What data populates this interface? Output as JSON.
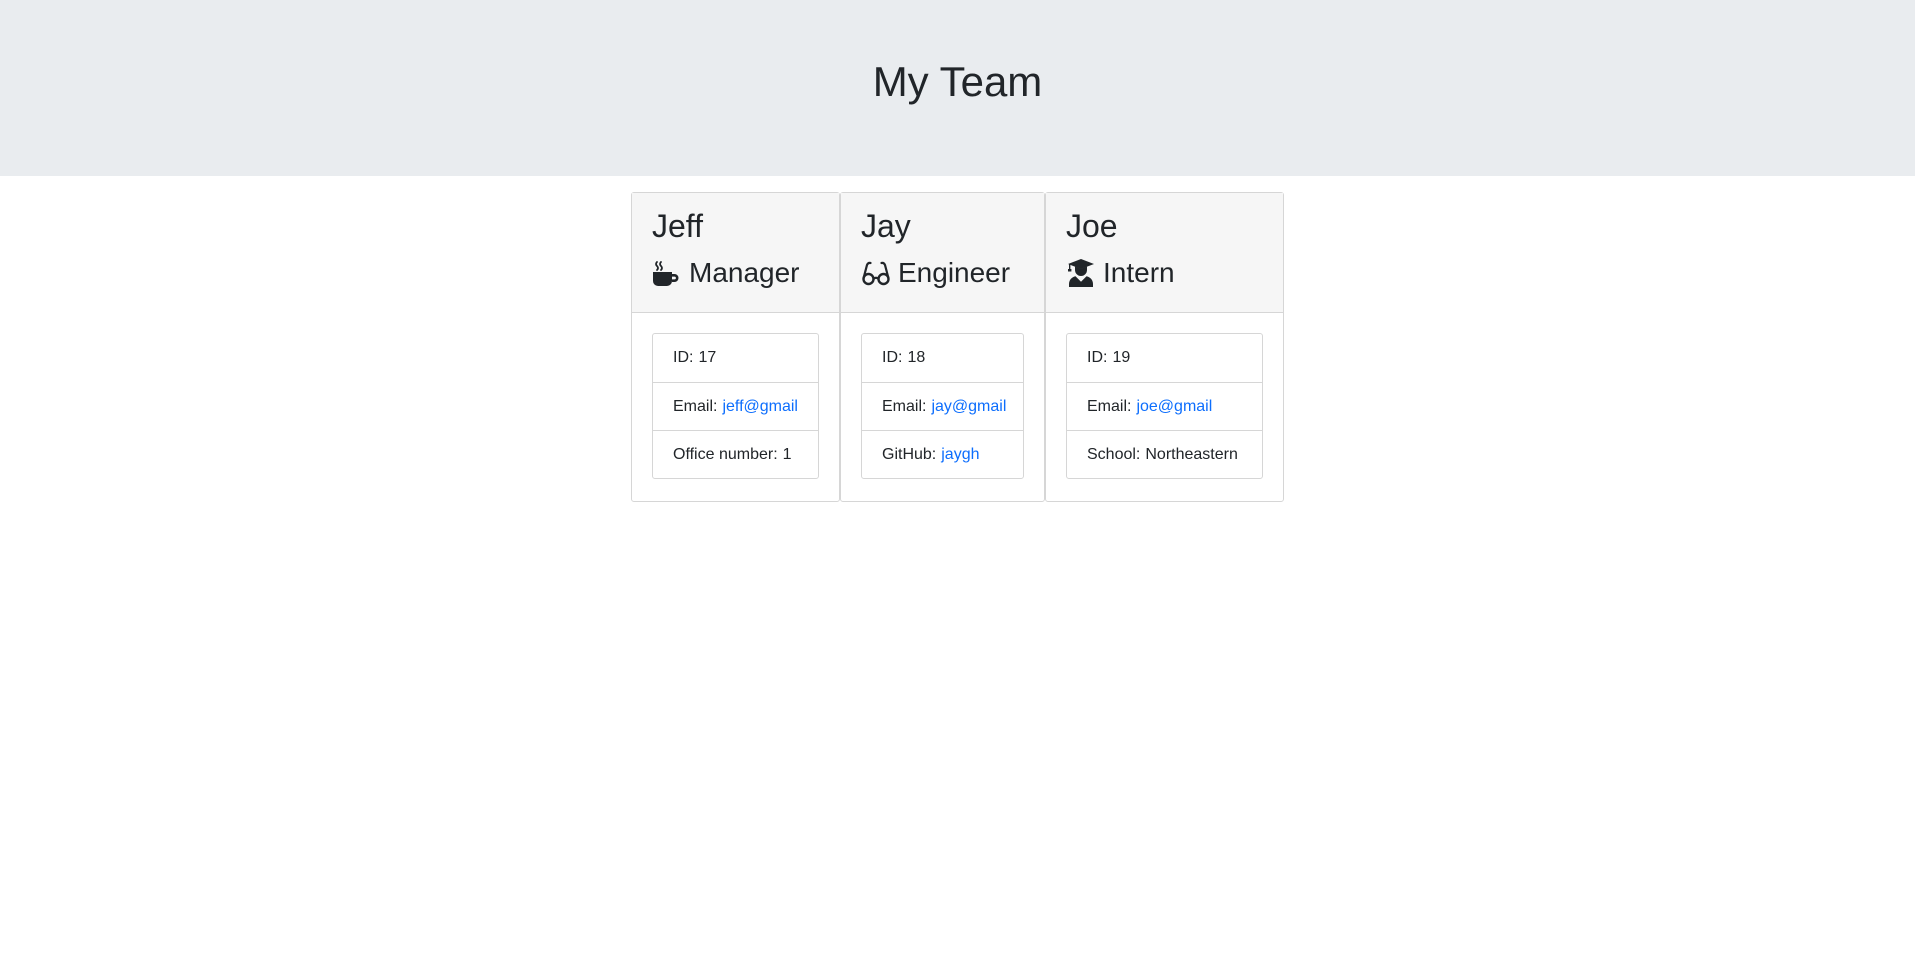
{
  "header": {
    "title": "My Team"
  },
  "team": [
    {
      "name": "Jeff",
      "role": "Manager",
      "icon": "coffee-mug-icon",
      "id_label": "ID:",
      "id": "17",
      "email_label": "Email:",
      "email": "jeff@gmail",
      "extra_label": "Office number:",
      "extra_value": "1"
    },
    {
      "name": "Jay",
      "role": "Engineer",
      "icon": "glasses-icon",
      "id_label": "ID:",
      "id": "18",
      "email_label": "Email:",
      "email": "jay@gmail",
      "extra_label": "GitHub:",
      "extra_value": "jaygh"
    },
    {
      "name": "Joe",
      "role": "Intern",
      "icon": "graduate-icon",
      "id_label": "ID:",
      "id": "19",
      "email_label": "Email:",
      "email": "joe@gmail",
      "extra_label": "School:",
      "extra_value": "Northeastern"
    }
  ],
  "colors": {
    "header_bg": "#e9ecef",
    "card_header_bg": "#f6f6f6",
    "link": "#0d6efd",
    "text": "#212529"
  }
}
